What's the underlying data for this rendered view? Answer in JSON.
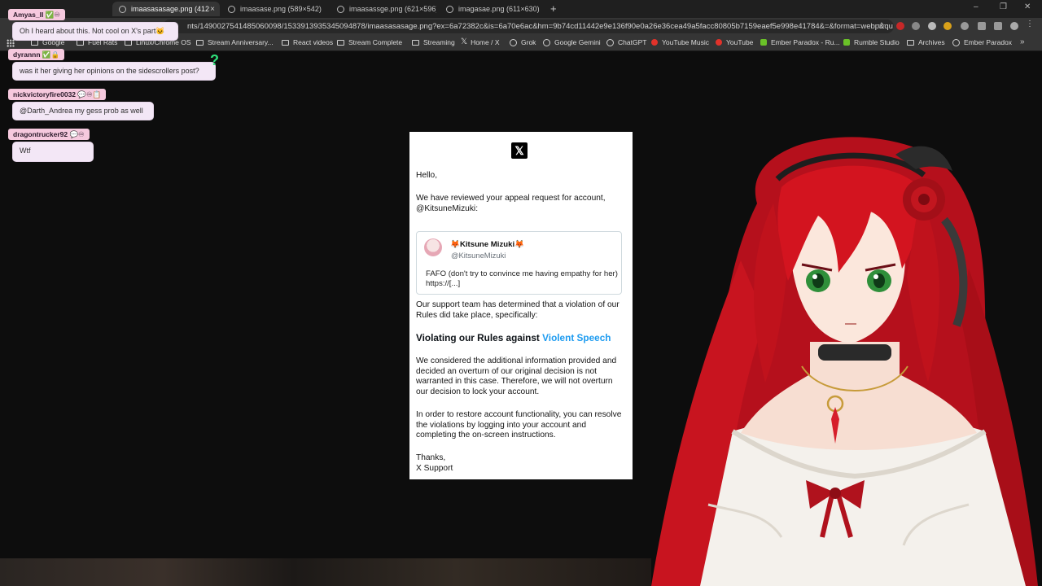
{
  "browser": {
    "tabs": [
      {
        "title": "imaasasasage.png (412×6",
        "active": true
      },
      {
        "title": "imaasase.png (589×542)",
        "active": false
      },
      {
        "title": "imaasassge.png (621×596)",
        "active": false
      },
      {
        "title": "imagasae.png (611×630)",
        "active": false
      }
    ],
    "new_tab": "+",
    "close_glyph": "×",
    "window_controls": {
      "minimize": "–",
      "restore": "❐",
      "close": "✕"
    },
    "url": "nts/1490027541485060098/1533913935345094878/imaasasasage.png?ex=6a72382c&is=6a70e6ac&hm=9b74cd11442e9e136f90e0a26e36cea49a5facc80805b7159eaef5e998e41784&=&format=webp&qu...",
    "bookmarks": [
      {
        "label": "Google",
        "icon": "folder"
      },
      {
        "label": "Fuel Rats",
        "icon": "folder"
      },
      {
        "label": "Linux/Chrome OS",
        "icon": "folder"
      },
      {
        "label": "Stream Anniversary...",
        "icon": "folder"
      },
      {
        "label": "React videos",
        "icon": "folder"
      },
      {
        "label": "Stream Complete",
        "icon": "folder"
      },
      {
        "label": "Streaming",
        "icon": "folder"
      },
      {
        "label": "Home / X",
        "icon": "x"
      },
      {
        "label": "Grok",
        "icon": "grok"
      },
      {
        "label": "Google Gemini",
        "icon": "gemini"
      },
      {
        "label": "ChatGPT",
        "icon": "chatgpt"
      },
      {
        "label": "YouTube Music",
        "icon": "youtube-music"
      },
      {
        "label": "YouTube",
        "icon": "youtube"
      },
      {
        "label": "Ember Paradox - Ru...",
        "icon": "rumble"
      },
      {
        "label": "Rumble Studio",
        "icon": "rumble"
      },
      {
        "label": "Archives",
        "icon": "folder"
      },
      {
        "label": "Ember Paradox",
        "icon": "avatar"
      }
    ],
    "more_bookmarks": "»"
  },
  "chat": [
    {
      "user": "Amyas_II",
      "badges": "✅♾",
      "message": "Oh I heard about this. Not cool on X's part🐱"
    },
    {
      "user": "dyrannn",
      "badges": "✅🔒",
      "message": "was it her giving her opinions on the sidescrollers post?"
    },
    {
      "user": "nickvictoryfire0032",
      "badges": "💬♾📋",
      "message": "@Darth_Andrea my gess prob as well"
    },
    {
      "user": "dragontrucker92",
      "badges": "💬♾",
      "message": "Wtf"
    }
  ],
  "chat_extra": {
    "question_mark": "?"
  },
  "email": {
    "logo": "𝕏",
    "greeting": "Hello,",
    "intro": "We have reviewed your appeal request for account, @KitsuneMizuki:",
    "quote": {
      "name": "🦊Kitsune Mizuki🦊",
      "handle": "@KitsuneMizuki",
      "text": "FAFO (don't try to convince me having empathy for her) https://[...]"
    },
    "determination": "Our support team has determined that a violation of our Rules did take place, specifically:",
    "rule_prefix": "Violating our Rules against ",
    "rule_link": "Violent Speech",
    "decision": "We considered the additional information provided and decided an overturn of our original decision is not warranted in this case. Therefore, we will not overturn our decision to lock your account.",
    "restore": "In order to restore account functionality, you can resolve the violations by logging into your account and completing the on-screen instructions.",
    "thanks": "Thanks,",
    "signature": "X Support"
  }
}
